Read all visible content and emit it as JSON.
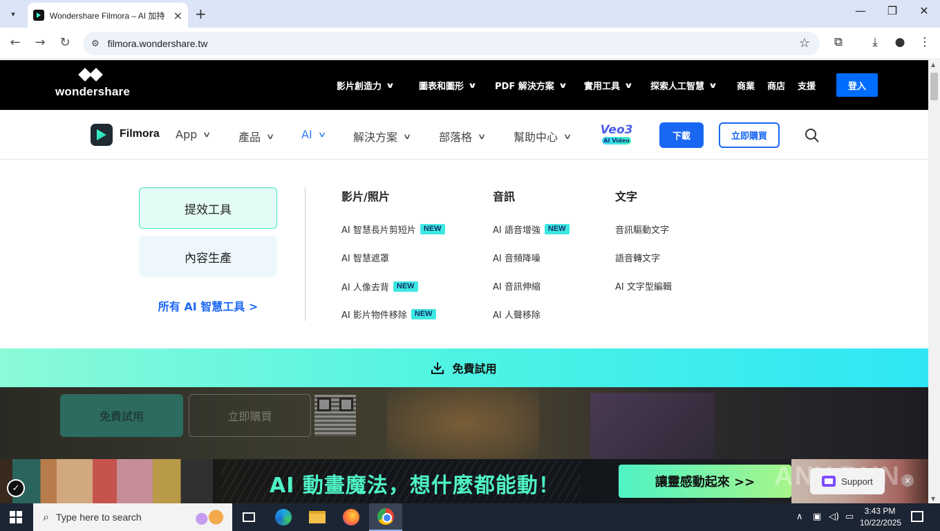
{
  "browser": {
    "tab_title": "Wondershare Filmora – AI 加持",
    "url": "filmora.wondershare.tw",
    "controls": {
      "minimize": "—",
      "maximize": "❐",
      "close": "✕"
    }
  },
  "ws_header": {
    "logo_text": "wondershare",
    "nav": [
      {
        "label": "影片創造力",
        "chevron": true
      },
      {
        "label": "圖表和圖形",
        "chevron": true
      },
      {
        "label": "PDF 解決方案",
        "chevron": true
      },
      {
        "label": "實用工具",
        "chevron": true
      },
      {
        "label": "探索人工智慧",
        "chevron": true
      },
      {
        "label": "商業",
        "chevron": false
      },
      {
        "label": "商店",
        "chevron": false
      },
      {
        "label": "支援",
        "chevron": false
      }
    ],
    "login_label": "登入"
  },
  "filmora_nav": {
    "brand": "Filmora",
    "items": [
      {
        "label": "App",
        "active": false
      },
      {
        "label": "產品",
        "active": false
      },
      {
        "label": "AI",
        "active": true
      },
      {
        "label": "解決方案",
        "active": false
      },
      {
        "label": "部落格",
        "active": false
      },
      {
        "label": "幫助中心",
        "active": false
      }
    ],
    "veo_title": "Veo3",
    "veo_sub": "AI Video",
    "download_label": "下載",
    "buy_label": "立即購買"
  },
  "mega_menu": {
    "categories": [
      "提效工具",
      "內容生產"
    ],
    "all_tools_link": "所有 AI 智慧工具 >",
    "badge_label": "NEW",
    "columns": [
      {
        "title": "影片/照片",
        "items": [
          {
            "label": "AI 智慧長片剪短片",
            "new": true
          },
          {
            "label": "AI 智慧遮罩",
            "new": false
          },
          {
            "label": "AI 人像去背",
            "new": true
          },
          {
            "label": "AI 影片物件移除",
            "new": true
          }
        ]
      },
      {
        "title": "音訊",
        "items": [
          {
            "label": "AI 語音增強",
            "new": true
          },
          {
            "label": "AI 音頻降噪",
            "new": false
          },
          {
            "label": "AI 音訊伸縮",
            "new": false
          },
          {
            "label": "AI 人聲移除",
            "new": false
          }
        ]
      },
      {
        "title": "文字",
        "items": [
          {
            "label": "音訊驅動文字",
            "new": false
          },
          {
            "label": "語音轉文字",
            "new": false
          },
          {
            "label": "AI 文字型編輯",
            "new": false
          }
        ]
      }
    ]
  },
  "trial_bar": {
    "label": "免費試用"
  },
  "hero": {
    "free_label": "免費試用",
    "buy_label": "立即購買"
  },
  "promo": {
    "title": "AI 動畫魔法，想什麼都能動！",
    "cta": "讓靈感動起來 >>",
    "support_label": "Support",
    "watermark": "ANY.RUN"
  },
  "taskbar": {
    "search_placeholder": "Type here to search",
    "time": "3:43 PM",
    "date": "10/22/2025"
  }
}
